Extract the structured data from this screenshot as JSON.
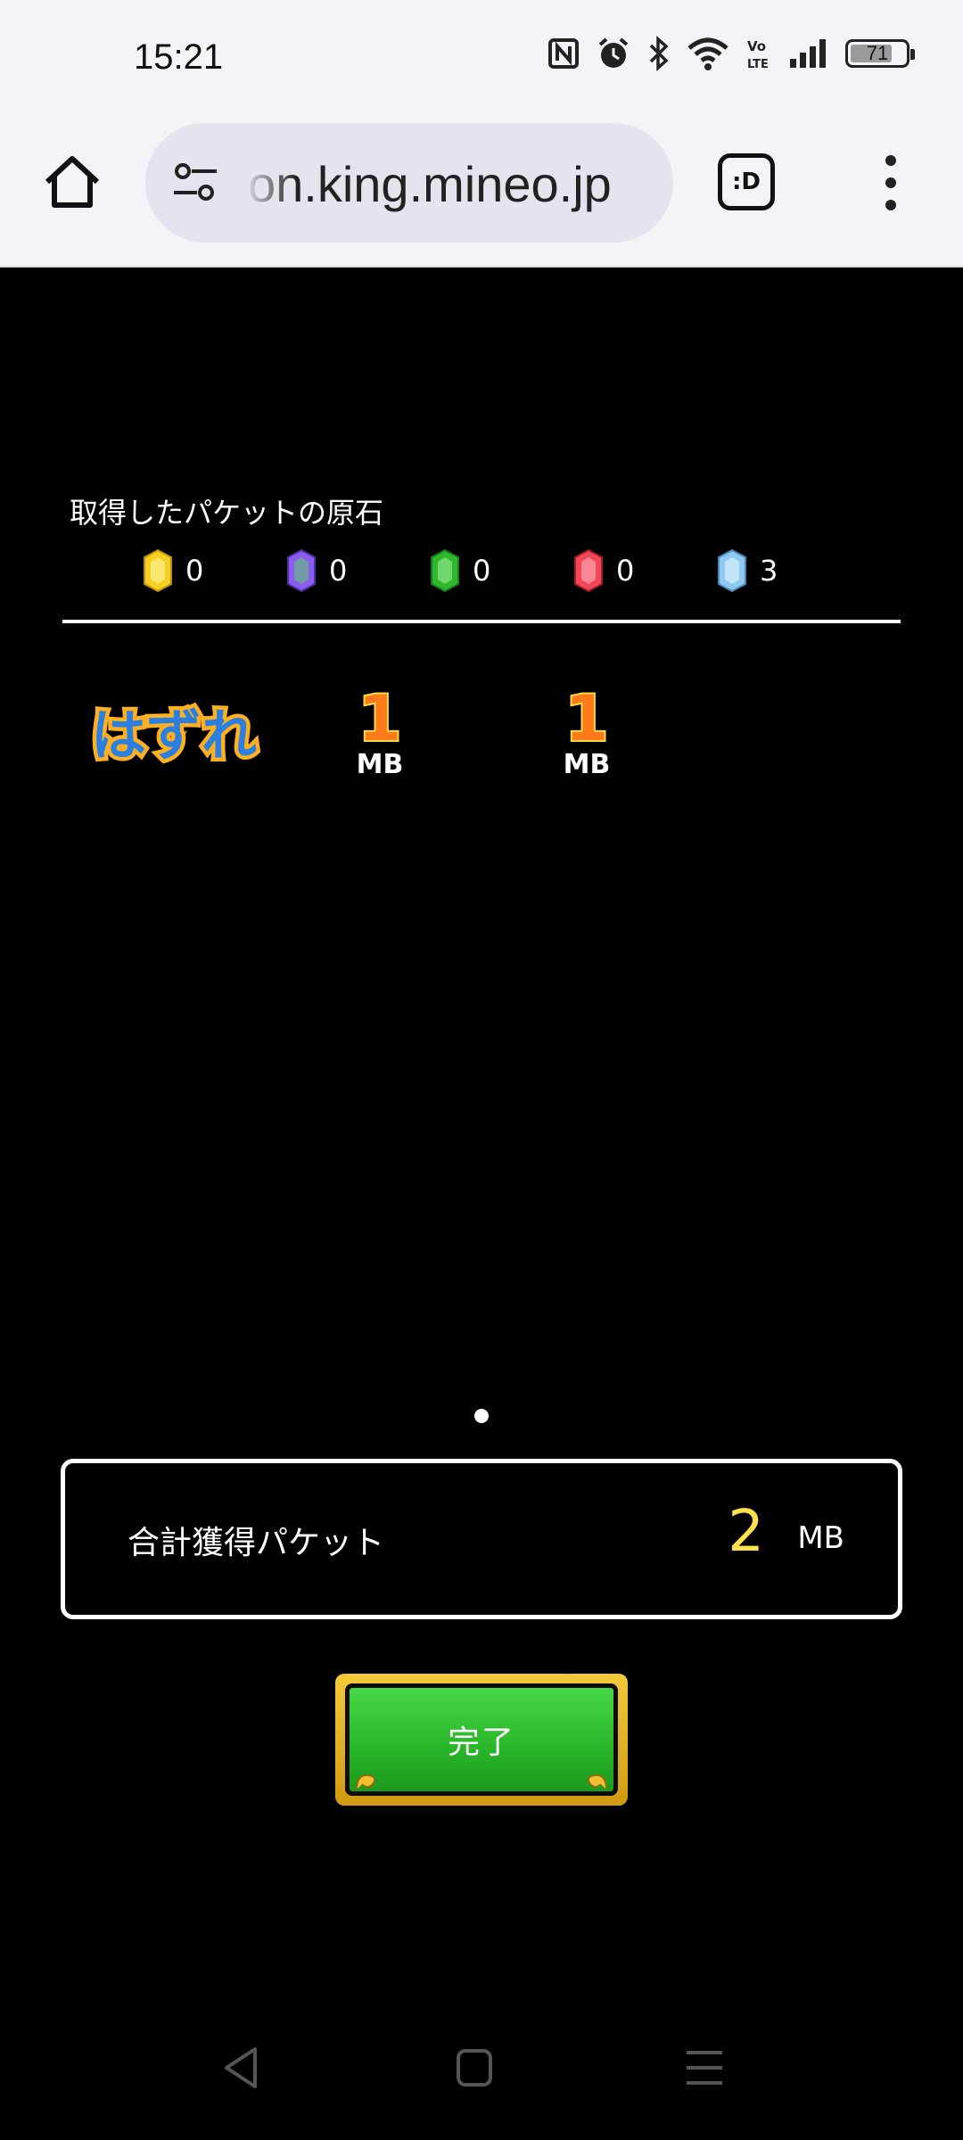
{
  "status_bar": {
    "time": "15:21",
    "battery_level": "71",
    "icons": [
      "nfc-icon",
      "alarm-icon",
      "bluetooth-icon",
      "wifi-icon",
      "volte-icon",
      "signal-icon",
      "battery-icon"
    ]
  },
  "browser": {
    "url": "on.king.mineo.jp",
    "tab_label": ":D",
    "icons": [
      "home-icon",
      "site-settings-icon",
      "tab-switcher-icon",
      "more-menu-icon"
    ]
  },
  "gems": {
    "title": "取得したパケットの原石",
    "items": [
      {
        "color": "#f5d020",
        "count": "0"
      },
      {
        "color": "#8a5cf0",
        "count": "0"
      },
      {
        "color": "#2eb82e",
        "count": "0"
      },
      {
        "color": "#f04a5a",
        "count": "0"
      },
      {
        "color": "#8fc8f0",
        "count": "3"
      }
    ]
  },
  "results": {
    "miss_label": "はずれ",
    "prizes": [
      {
        "value": "1",
        "unit": "MB"
      },
      {
        "value": "1",
        "unit": "MB"
      }
    ]
  },
  "total": {
    "label": "合計獲得パケット",
    "value": "2",
    "unit": "MB"
  },
  "done_button": {
    "label": "完了"
  },
  "nav": {
    "icons": [
      "back-icon",
      "home-square-icon",
      "recents-icon"
    ]
  }
}
